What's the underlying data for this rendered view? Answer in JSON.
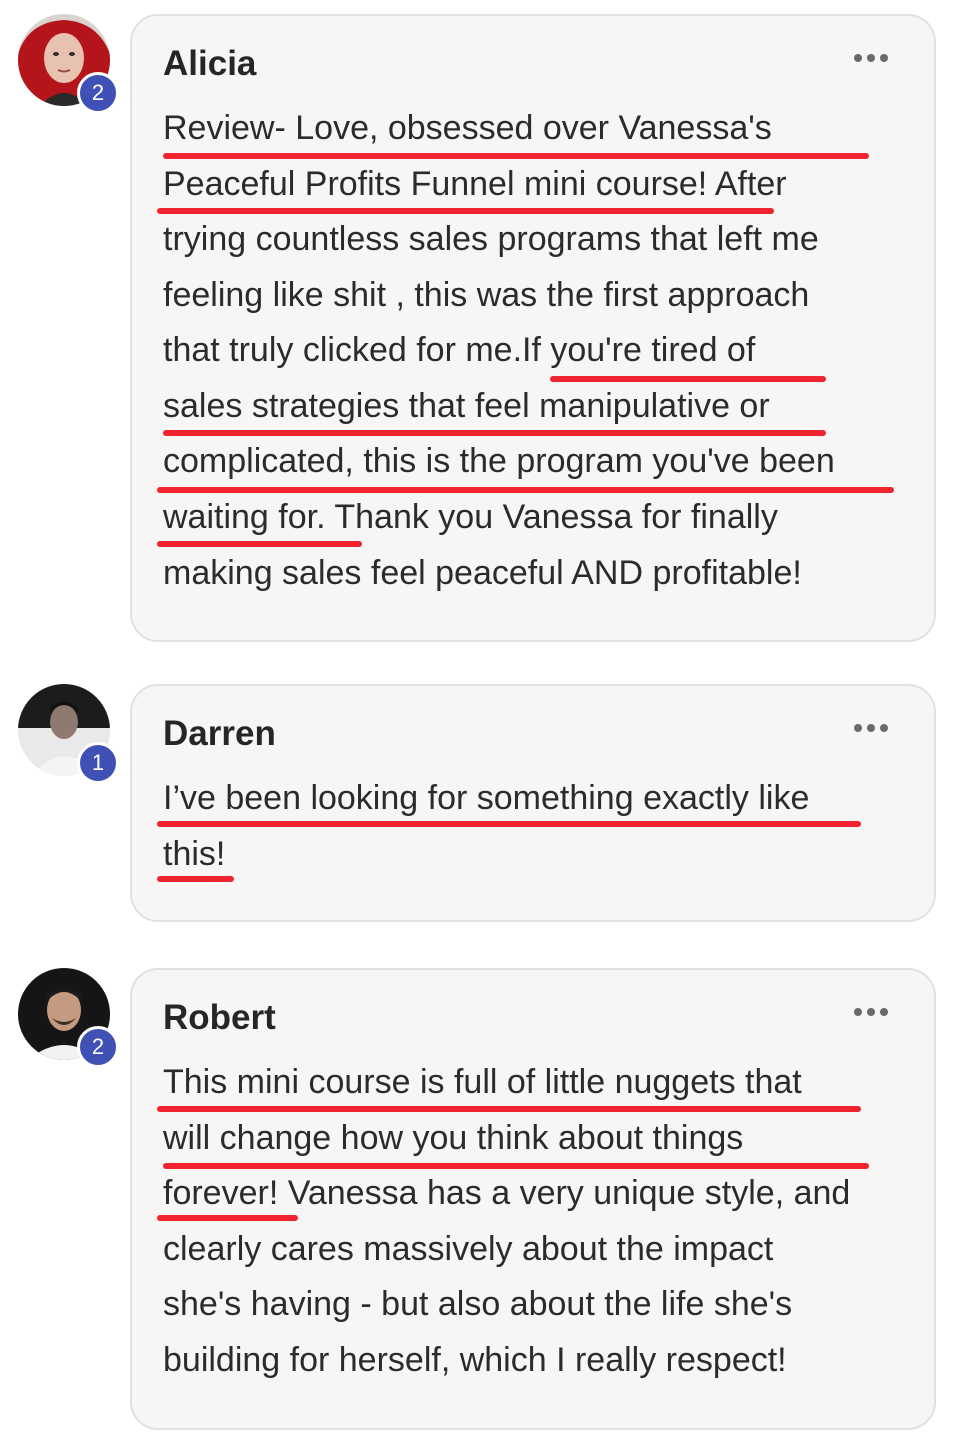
{
  "comments": [
    {
      "author": "Alicia",
      "badge": "2",
      "text_lines": [
        "Review- Love, obsessed over Vanessa's",
        "Peaceful Profits Funnel mini course! After",
        "trying countless sales programs that left me",
        "feeling like shit , this was the first approach",
        "that truly clicked for me.If you're tired of",
        "sales strategies that feel manipulative or",
        "complicated, this is the program you've been",
        "waiting for. Thank you Vanessa for finally",
        "making sales feel peaceful AND profitable!"
      ]
    },
    {
      "author": "Darren",
      "badge": "1",
      "text_lines": [
        "I’ve been looking for something exactly like",
        "this!"
      ]
    },
    {
      "author": "Robert",
      "badge": "2",
      "text_lines": [
        "This mini course is full of little nuggets that",
        "will change how you think about things",
        "forever! Vanessa has a very unique style, and",
        "clearly cares massively about the impact",
        "she's having - but also about the life she's",
        "building for herself, which I really respect!"
      ]
    }
  ],
  "highlight_color": "#f0232f",
  "badge_color": "#3f51b5"
}
